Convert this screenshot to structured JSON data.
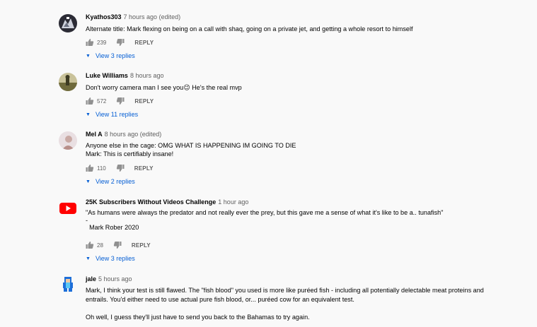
{
  "comments": [
    {
      "author": "Kyathos303",
      "time": "7 hours ago (edited)",
      "text": "Alternate title: Mark flexing on being on a call with shaq, going on a private jet, and getting a whole resort to himself",
      "likes": "239",
      "reply_label": "REPLY",
      "replies_label": "View 3 replies",
      "avatar": "gamer-avatar-icon"
    },
    {
      "author": "Luke Williams",
      "time": "8 hours ago",
      "text": "Don't worry camera man I see you😉 He's the real mvp",
      "likes": "572",
      "reply_label": "REPLY",
      "replies_label": "View 11 replies",
      "avatar": "landscape-avatar-icon"
    },
    {
      "author": "Mel A",
      "time": "8 hours ago (edited)",
      "text": "Anyone else in the cage: OMG WHAT IS HAPPENING IM GOING TO DIE\nMark: This is certifiably insane!",
      "likes": "110",
      "reply_label": "REPLY",
      "replies_label": "View 2 replies",
      "avatar": "photo-avatar-icon"
    },
    {
      "author": "25K Subscribers Without Videos Challenge",
      "time": "1 hour ago",
      "text": "\"As humans were always the predator and not really ever the prey, but this gave me a sense of what it's like to be a.. tunafish\"\n-\n  Mark Rober 2020",
      "likes": "28",
      "reply_label": "REPLY",
      "replies_label": "View 3 replies",
      "avatar": "youtube-logo-icon"
    },
    {
      "author": "jale",
      "time": "5 hours ago",
      "text": "Mark, I think your test is still flawed. The \"fish blood\" you used is more like puréed fish - including all potentially delectable meat proteins and entrails. You'd either need to use actual pure fish blood, or... puréed cow for an equivalent test.\n\nOh well, I guess they'll just have to send you back to the Bahamas to try again.",
      "avatar": "megaman-avatar-icon"
    }
  ],
  "colors": {
    "link": "#065fd4",
    "meta": "#606060",
    "text": "#030303",
    "youtube_red": "#ff0000"
  }
}
